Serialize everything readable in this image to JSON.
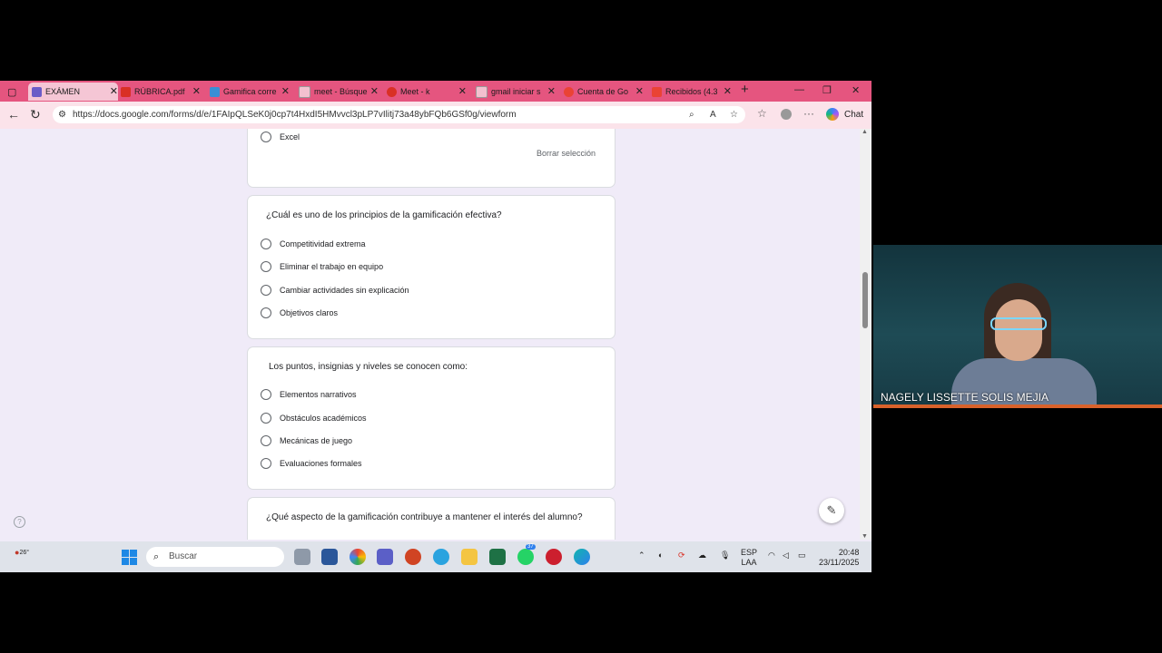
{
  "browser": {
    "tabs": [
      {
        "label": "EXÁMEN",
        "color": "#6b5cc7",
        "active": true
      },
      {
        "label": "RÚBRICA.pdf",
        "color": "#d93025",
        "active": false
      },
      {
        "label": "Gamifica corre",
        "color": "#3a8fd6",
        "active": false
      },
      {
        "label": "meet - Búsque",
        "color": "#ffffff",
        "active": false
      },
      {
        "label": "Meet - k",
        "color": "#d93025",
        "active": false
      },
      {
        "label": "gmail iniciar s",
        "color": "#ffffff",
        "active": false
      },
      {
        "label": "Cuenta de Go",
        "color": "#ea4335",
        "active": false
      },
      {
        "label": "Recibidos (4.3",
        "color": "#ea4335",
        "active": false
      }
    ],
    "url": "https://docs.google.com/forms/d/e/1FAIpQLSeK0j0cp7t4HxdI5HMvvcl3pLP7vIlitj73a48ybFQb6GSf0g/viewform",
    "chat_label": "Chat"
  },
  "form": {
    "prev_option": "Excel",
    "clear_selection": "Borrar selección",
    "questions": [
      {
        "text": "¿Cuál es uno de los principios de la gamificación efectiva?",
        "options": [
          "Competitividad extrema",
          "Eliminar el trabajo en equipo",
          "Cambiar actividades sin explicación",
          "Objetivos claros"
        ]
      },
      {
        "text": "Los puntos, insignias y niveles se conocen como:",
        "options": [
          "Elementos narrativos",
          "Obstáculos académicos",
          "Mecánicas de juego",
          "Evaluaciones formales"
        ]
      },
      {
        "text": "¿Qué aspecto de la gamificación contribuye a mantener el interés del alumno?",
        "options": []
      }
    ]
  },
  "taskbar": {
    "weather": "26°",
    "search_placeholder": "Buscar",
    "whatsapp_badge": "37",
    "lang_top": "ESP",
    "lang_bottom": "LAA",
    "time": "20:48",
    "date": "23/11/2025"
  },
  "video": {
    "participant_name": "NAGELY LISSETTE SOLIS MEJIA"
  }
}
